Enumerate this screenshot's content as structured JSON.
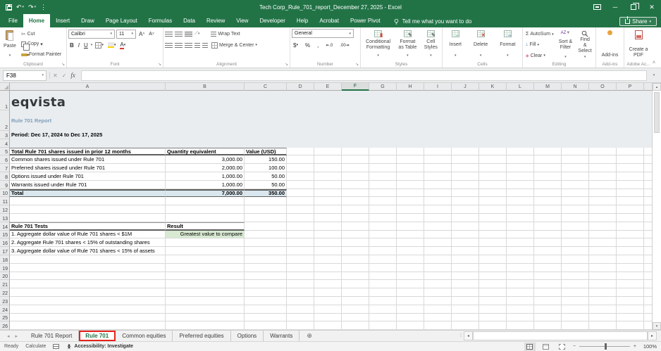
{
  "window": {
    "title": "Tech Corp_Rule_701_report_December 27, 2025 - Excel",
    "share_label": "Share",
    "tell_me": "Tell me what you want to do"
  },
  "colors": {
    "excel_green": "#217346",
    "header_band_bg": "#e9edf0",
    "total_row_bg": "#dae7ee",
    "result_cell_bg": "#d8ead2",
    "tab_highlight_red": "#e5241d",
    "report_title_color": "#7f9db9"
  },
  "icons": {
    "undo": "↶",
    "redo": "↷",
    "qat_more": "⋮",
    "minimize": "─",
    "close": "✕",
    "dropdown": "▾",
    "up": "▴",
    "left": "◂",
    "right": "▸",
    "cut": "✂",
    "bold": "B",
    "italic": "I",
    "underline": "U",
    "font_bigger": "A",
    "font_smaller": "A",
    "autosum": "Σ",
    "fill_arrow": "↓",
    "clear": "◆",
    "sort_az": "AZ",
    "funnel": "▼",
    "launcher": "↘",
    "cancel": "✕",
    "enter": "✓",
    "fx": "fx",
    "plus": "+",
    "minus": "−",
    "new_sheet": "⊕",
    "splitter": "⁞"
  },
  "ribbon_tabs": [
    "File",
    "Home",
    "Insert",
    "Draw",
    "Page Layout",
    "Formulas",
    "Data",
    "Review",
    "View",
    "Developer",
    "Help",
    "Acrobat",
    "Power Pivot"
  ],
  "active_tab": "Home",
  "ribbon": {
    "clipboard": {
      "label": "Clipboard",
      "paste": "Paste",
      "cut": "Cut",
      "copy": "Copy",
      "format_painter": "Format Painter"
    },
    "font": {
      "label": "Font",
      "family": "Calibri",
      "size": "11"
    },
    "alignment": {
      "label": "Alignment",
      "wrap_text": "Wrap Text",
      "merge_center": "Merge & Center"
    },
    "number": {
      "label": "Number",
      "format": "General",
      "currency": "$",
      "percent": "%",
      "comma": ",",
      "inc_dec": "↞.0",
      "dec_dec": ".00↠"
    },
    "styles": {
      "label": "Styles",
      "conditional": "Conditional Formatting",
      "format_table": "Format as Table",
      "cell_styles": "Cell Styles"
    },
    "cells": {
      "label": "Cells",
      "insert": "Insert",
      "delete": "Delete",
      "format": "Format"
    },
    "editing": {
      "label": "Editing",
      "autosum": "AutoSum",
      "fill": "Fill",
      "clear": "Clear",
      "sort_filter": "Sort & Filter",
      "find_select": "Find & Select"
    },
    "addins": {
      "label": "Add-ins",
      "button": "Add-ins"
    },
    "acrobat": {
      "label": "Adobe Ac...",
      "create_pdf": "Create a PDF"
    }
  },
  "formula_bar": {
    "name_box": "F38",
    "formula": ""
  },
  "grid": {
    "columns": [
      "A",
      "B",
      "C",
      "D",
      "E",
      "F",
      "G",
      "H",
      "I",
      "J",
      "K",
      "L",
      "M",
      "N",
      "O",
      "P"
    ],
    "selected_column": "F",
    "visible_rows": 26,
    "content": {
      "logo": "eqvista",
      "report_title": "Rule 701 Report",
      "period": "Period: Dec 17, 2024 to Dec 17, 2025",
      "shares_table": {
        "headers": [
          "Total Rule 701 shares issued in prior 12 months",
          "Quantity equivalent",
          "Value (USD)"
        ],
        "rows": [
          [
            "Common shares issued under Rule 701",
            "3,000.00",
            "150.00"
          ],
          [
            "Preferred shares issued under Rule 701",
            "2,000.00",
            "100.00"
          ],
          [
            "Options issued under Rule 701",
            "1,000.00",
            "50.00"
          ],
          [
            "Warrants issued under Rule 701",
            "1,000.00",
            "50.00"
          ]
        ],
        "total": [
          "Total",
          "7,000.00",
          "350.00"
        ]
      },
      "tests_table": {
        "headers": [
          "Rule 701 Tests",
          "Result"
        ],
        "rows": [
          [
            "1. Aggregate dollar value of Rule 701 shares < $1M",
            "Greatest value to compare"
          ],
          [
            "2. Aggregate Rule 701 shares < 15% of outstanding shares",
            ""
          ],
          [
            "3. Aggregate dollar value of Rule 701 shares < 15% of assets",
            ""
          ]
        ]
      }
    }
  },
  "sheet_tabs": {
    "tabs": [
      {
        "label": "Rule 701 Report",
        "active": false
      },
      {
        "label": "Rule 701",
        "active": true
      },
      {
        "label": "Common equities",
        "active": false
      },
      {
        "label": "Preferred equities",
        "active": false
      },
      {
        "label": "Options",
        "active": false
      },
      {
        "label": "Warrants",
        "active": false
      }
    ]
  },
  "status_bar": {
    "mode": "Ready",
    "calculate": "Calculate",
    "accessibility": "Accessibility: Investigate",
    "zoom": "100%"
  }
}
